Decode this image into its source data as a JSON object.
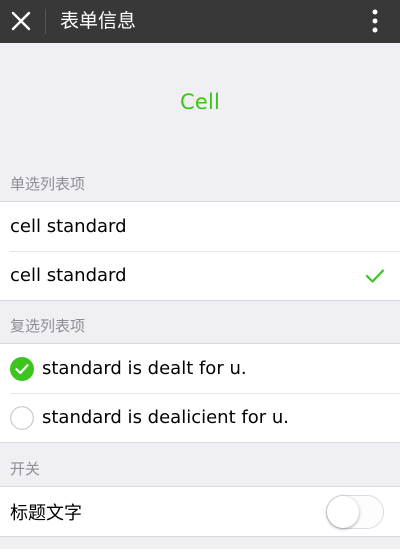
{
  "navbar": {
    "close_icon": "close-icon",
    "title": "表单信息",
    "more_icon": "more-vertical-icon"
  },
  "page": {
    "title": "Cell"
  },
  "radio_section": {
    "label": "单选列表项",
    "items": [
      {
        "label": "cell standard",
        "checked": false
      },
      {
        "label": "cell standard",
        "checked": true
      }
    ]
  },
  "checkbox_section": {
    "label": "复选列表项",
    "items": [
      {
        "label": "standard is dealt for u.",
        "checked": true
      },
      {
        "label": "standard is dealicient for u.",
        "checked": false
      }
    ]
  },
  "switch_section": {
    "label": "开关",
    "items": [
      {
        "label": "标题文字",
        "on": false
      }
    ]
  },
  "colors": {
    "accent": "#3cc51f",
    "navbar_bg": "#383838",
    "page_bg": "#efeff4",
    "section_label": "#8e8e93"
  }
}
